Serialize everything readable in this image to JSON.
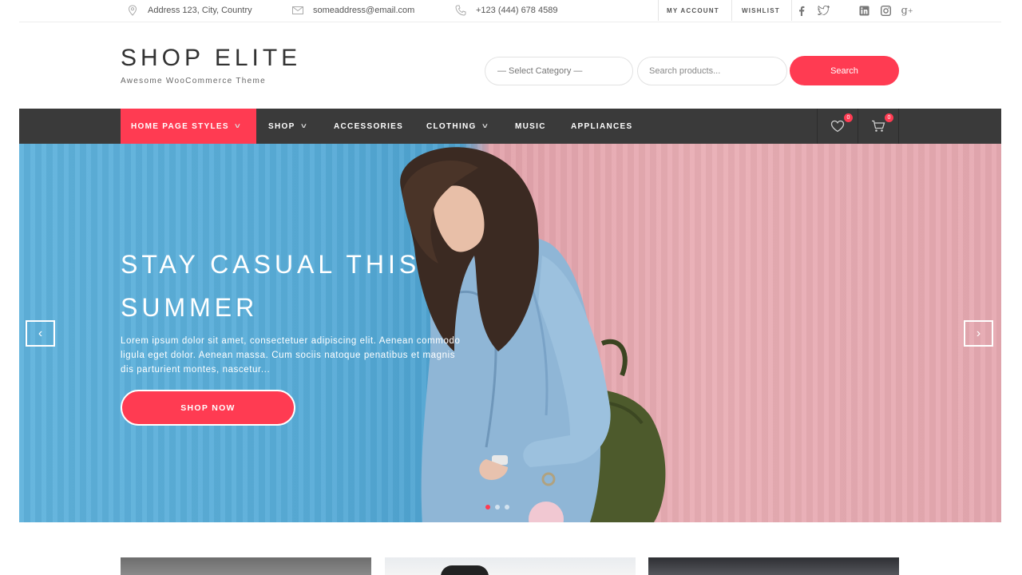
{
  "topbar": {
    "address": "Address 123, City, Country",
    "email": "someaddress@email.com",
    "phone": "+123 (444) 678 4589",
    "my_account": "MY ACCOUNT",
    "wishlist": "WISHLIST",
    "social": [
      "facebook-icon",
      "twitter-icon",
      "linkedin-icon",
      "instagram-icon",
      "google-plus-icon"
    ]
  },
  "header": {
    "logo_title": "SHOP ELITE",
    "logo_subtitle": "Awesome WooCommerce Theme",
    "category_select": "— Select Category —",
    "search_placeholder": "Search products...",
    "search_button": "Search"
  },
  "nav": {
    "items": [
      {
        "label": "HOME PAGE STYLES",
        "dropdown": true
      },
      {
        "label": "SHOP",
        "dropdown": true
      },
      {
        "label": "ACCESSORIES",
        "dropdown": false
      },
      {
        "label": "CLOTHING",
        "dropdown": true
      },
      {
        "label": "MUSIC",
        "dropdown": false
      },
      {
        "label": "APPLIANCES",
        "dropdown": false
      }
    ],
    "wishlist_count": "0",
    "cart_count": "0"
  },
  "hero": {
    "title_line1": "STAY CASUAL THIS",
    "title_line2": "SUMMER",
    "text_line1": "Lorem ipsum dolor sit amet, consectetuer adipiscing elit. Aenean commodo",
    "text_line2": "ligula eget dolor. Aenean massa. Cum sociis natoque penatibus et magnis",
    "text_line3": "dis parturient montes, nascetur...",
    "button": "SHOP NOW",
    "slide_count": 3,
    "active_slide": 1
  },
  "colors": {
    "accent": "#ff3b52",
    "nav_bg": "#3a3a3a",
    "hero_blue": "#58acd8",
    "hero_pink": "#e9aeb5"
  }
}
